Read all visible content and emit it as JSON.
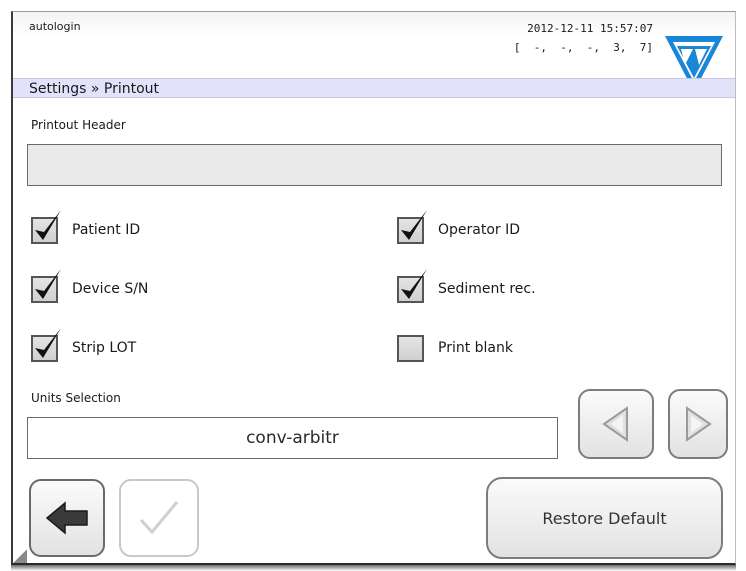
{
  "header": {
    "user": "autologin",
    "datetime": "2012-12-11 15:57:07",
    "status_line": "[  -,  -,  -,  3,  7]",
    "logo": "company-logo-triangle"
  },
  "breadcrumb": "Settings » Printout",
  "printout_header": {
    "label": "Printout Header",
    "value": ""
  },
  "options": {
    "patient_id": {
      "label": "Patient ID",
      "checked": true
    },
    "operator_id": {
      "label": "Operator ID",
      "checked": true
    },
    "device_sn": {
      "label": "Device S/N",
      "checked": true
    },
    "sediment_rec": {
      "label": "Sediment rec.",
      "checked": true
    },
    "strip_lot": {
      "label": "Strip LOT",
      "checked": true
    },
    "print_blank": {
      "label": "Print blank",
      "checked": false
    }
  },
  "units": {
    "label": "Units Selection",
    "value": "conv-arbitr"
  },
  "buttons": {
    "prev_icon": "triangle-left-icon",
    "next_icon": "triangle-right-icon",
    "back_icon": "arrow-left-icon",
    "ok_icon": "checkmark-icon",
    "restore_label": "Restore Default"
  },
  "colors": {
    "breadcrumb_bg": "#e2e2fb",
    "logo_blue": "#1a86d8"
  }
}
